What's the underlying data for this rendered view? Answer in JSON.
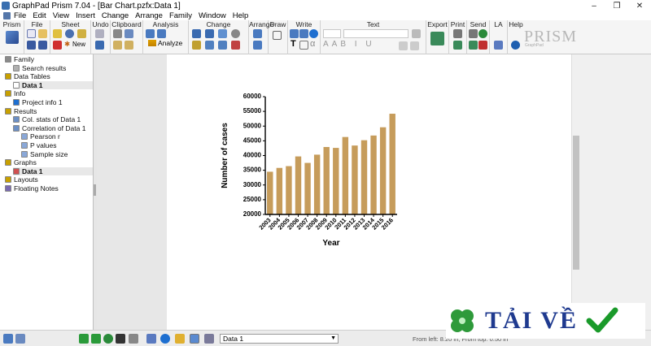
{
  "window": {
    "title": "GraphPad Prism 7.04 - [Bar Chart.pzfx:Data 1]",
    "controls": [
      "–",
      "❐",
      "✕"
    ]
  },
  "menu": [
    "File",
    "Edit",
    "View",
    "Insert",
    "Change",
    "Arrange",
    "Family",
    "Window",
    "Help"
  ],
  "ribbon": {
    "groups": [
      "Prism",
      "File",
      "Sheet",
      "Undo",
      "Clipboard",
      "Analysis",
      "Change",
      "Arrange",
      "Draw",
      "Write",
      "Text",
      "Export",
      "Print",
      "Send",
      "LA",
      "Help"
    ],
    "new_label": "New",
    "analyze_label": "Analyze",
    "logo_small": "GraphPad",
    "logo": "PRISM"
  },
  "navigator": {
    "items": [
      {
        "label": "Family",
        "indent": 0,
        "icon_color": "#8a8a8a",
        "selected": false
      },
      {
        "label": "Search results",
        "indent": 1,
        "icon_color": "#b0b0b0",
        "selected": false
      },
      {
        "label": "Data Tables",
        "indent": 0,
        "icon_color": "#c8a000",
        "selected": false
      },
      {
        "label": "Data 1",
        "indent": 1,
        "icon_color": "#ffffff",
        "selected": true
      },
      {
        "label": "Info",
        "indent": 0,
        "icon_color": "#c8a000",
        "selected": false
      },
      {
        "label": "Project info 1",
        "indent": 1,
        "icon_color": "#1e6fd0",
        "selected": false
      },
      {
        "label": "Results",
        "indent": 0,
        "icon_color": "#c8a000",
        "selected": false
      },
      {
        "label": "Col. stats of Data 1",
        "indent": 1,
        "icon_color": "#6b8fc5",
        "selected": false
      },
      {
        "label": "Correlation of Data 1",
        "indent": 1,
        "icon_color": "#6b8fc5",
        "selected": false
      },
      {
        "label": "Pearson r",
        "indent": 2,
        "icon_color": "#8aa8d8",
        "selected": false
      },
      {
        "label": "P values",
        "indent": 2,
        "icon_color": "#8aa8d8",
        "selected": false
      },
      {
        "label": "Sample size",
        "indent": 2,
        "icon_color": "#8aa8d8",
        "selected": false
      },
      {
        "label": "Graphs",
        "indent": 0,
        "icon_color": "#c8a000",
        "selected": false
      },
      {
        "label": "Data 1",
        "indent": 1,
        "icon_color": "#d05050",
        "selected": true
      },
      {
        "label": "Layouts",
        "indent": 0,
        "icon_color": "#c8a000",
        "selected": false
      },
      {
        "label": "Floating Notes",
        "indent": 0,
        "icon_color": "#7a6ab0",
        "selected": false
      }
    ]
  },
  "chart_data": {
    "type": "bar",
    "categories": [
      "2003",
      "2004",
      "2005",
      "2006",
      "2007",
      "2008",
      "2009",
      "2010",
      "2011",
      "2012",
      "2013",
      "2014",
      "2015",
      "2016"
    ],
    "values": [
      34500,
      35800,
      36400,
      39700,
      37500,
      40300,
      42900,
      42600,
      46300,
      43400,
      45200,
      46800,
      49600,
      54200
    ],
    "xlabel": "Year",
    "ylabel": "Number of cases",
    "ylim": [
      20000,
      60000
    ],
    "yticks": [
      20000,
      25000,
      30000,
      35000,
      40000,
      45000,
      50000,
      55000,
      60000
    ],
    "bar_color": "#c69c5b",
    "grid": false
  },
  "statusbar": {
    "sheet_selected": "Data 1",
    "coords_text": "From left: 8.20 in, From top: 0.50 in"
  },
  "watermark": {
    "text": "TẢI VỀ"
  }
}
